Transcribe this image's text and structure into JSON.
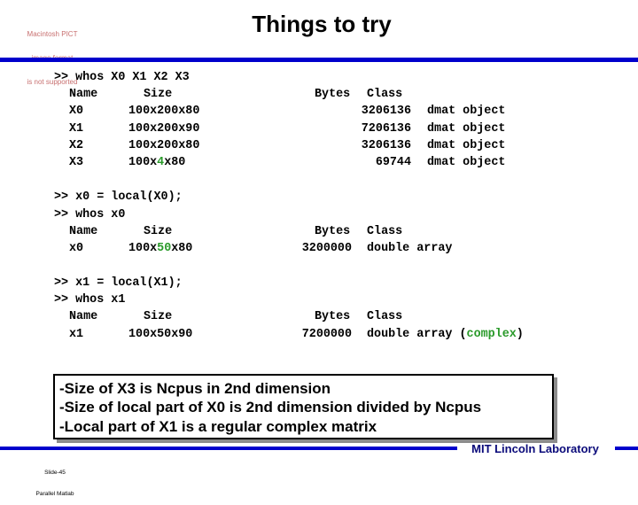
{
  "slide": {
    "placeholder_image_text": [
      "Macintosh PICT",
      "image format",
      "is not supported"
    ],
    "title": "Things to try",
    "accent_color": "#0000cc"
  },
  "session": {
    "cmd1": ">> whos X0 X1 X2 X3",
    "table1": {
      "headers": {
        "name": "Name",
        "size": "Size",
        "bytes": "Bytes",
        "class": "Class"
      },
      "rows": [
        {
          "name": "X0",
          "size_pre": "100x200x80",
          "size_hl": "",
          "size_post": "",
          "bytes": "3206136",
          "class": "dmat object"
        },
        {
          "name": "X1",
          "size_pre": "100x200x90",
          "size_hl": "",
          "size_post": "",
          "bytes": "7206136",
          "class": "dmat object"
        },
        {
          "name": "X2",
          "size_pre": "100x200x80",
          "size_hl": "",
          "size_post": "",
          "bytes": "3206136",
          "class": "dmat object"
        },
        {
          "name": "X3",
          "size_pre": "100x",
          "size_hl": "4",
          "size_post": "x80",
          "bytes": "69744",
          "class": "dmat object"
        }
      ]
    },
    "cmd2": ">> x0 = local(X0);",
    "cmd3": ">> whos x0",
    "table2": {
      "headers": {
        "name": "Name",
        "size": "Size",
        "bytes": "Bytes",
        "class": "Class"
      },
      "row": {
        "name": "x0",
        "size_pre": "100x",
        "size_hl": "50",
        "size_post": "x80",
        "bytes": "3200000",
        "class": "double array"
      }
    },
    "cmd4": ">> x1 = local(X1);",
    "cmd5": ">> whos x1",
    "table3": {
      "headers": {
        "name": "Name",
        "size": "Size",
        "bytes": "Bytes",
        "class": "Class"
      },
      "row": {
        "name": "x1",
        "size": "100x50x90",
        "bytes": "7200000",
        "class": "double array",
        "class_paren_open": "(",
        "class_hl": "complex",
        "class_paren_close": ")"
      }
    },
    "highlight_color": "#2a9a2a"
  },
  "notes": [
    "-Size of X3 is Ncpus in 2nd dimension",
    "-Size of local part of X0 is 2nd dimension divided by Ncpus",
    "-Local part of X1 is a regular complex matrix"
  ],
  "footer": {
    "org": "MIT Lincoln Laboratory",
    "slide_number": "Slide-45",
    "deck": "Parallel Matlab"
  }
}
